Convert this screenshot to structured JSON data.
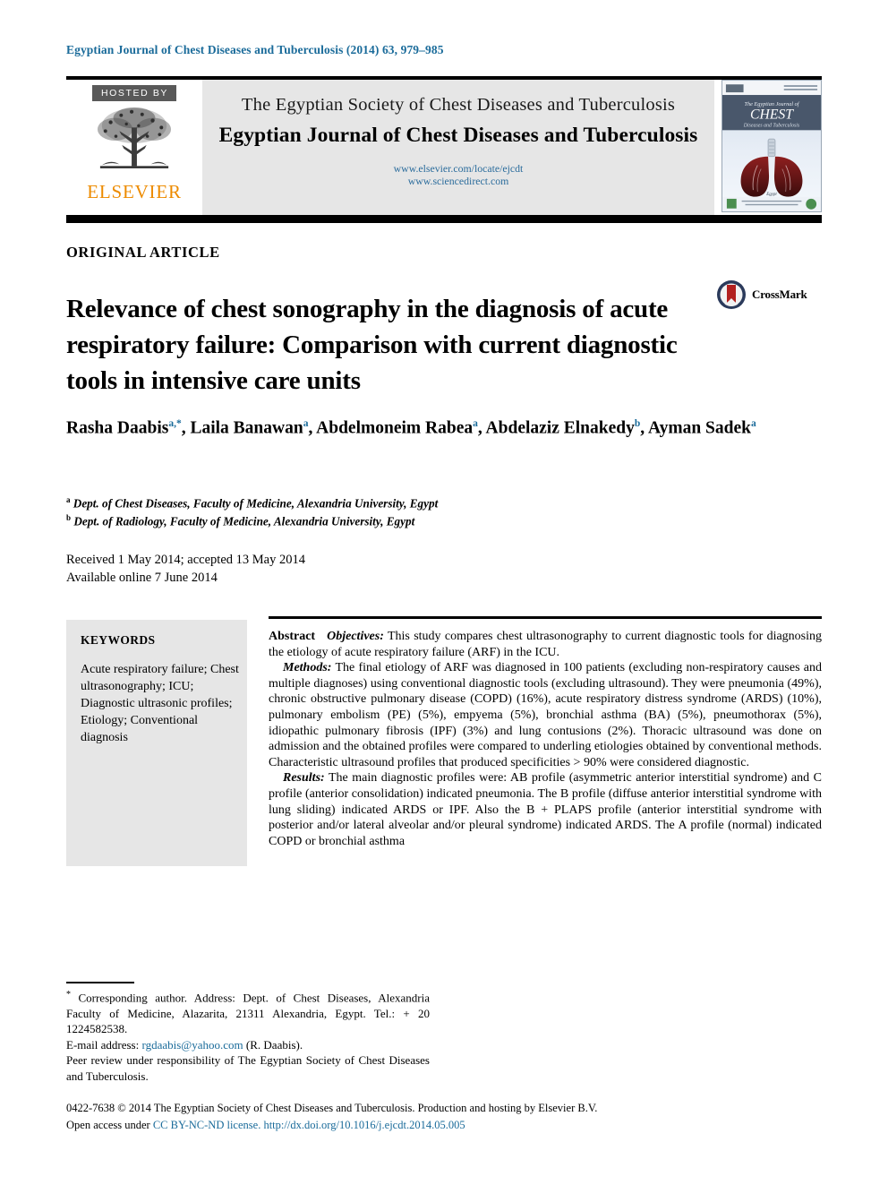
{
  "running_head": "Egyptian Journal of Chest Diseases and Tuberculosis (2014) 63, 979–985",
  "banner": {
    "hosted_by": "HOSTED BY",
    "publisher": "ELSEVIER",
    "society_line": "The Egyptian Society of Chest Diseases and Tuberculosis",
    "journal_line": "Egyptian Journal of Chest Diseases and Tuberculosis",
    "url_1": "www.elsevier.com/locate/ejcdt",
    "url_2": "www.sciencedirect.com",
    "cover": {
      "line1": "The Egyptian Journal of",
      "line2": "CHEST",
      "line3": "Diseases and Tuberculosis",
      "footer": "Egypt"
    }
  },
  "article": {
    "type": "ORIGINAL ARTICLE",
    "title": "Relevance of chest sonography in the diagnosis of acute respiratory failure: Comparison with current diagnostic tools in intensive care units",
    "crossmark_label": "CrossMark",
    "authors_line_1": "Rasha Daabis",
    "authors": [
      {
        "name": "Rasha Daabis",
        "marker": "a,*"
      },
      {
        "name": "Laila Banawan",
        "marker": "a"
      },
      {
        "name": "Abdelmoneim Rabea",
        "marker": "a"
      },
      {
        "name": "Abdelaziz Elnakedy",
        "marker": "b"
      },
      {
        "name": "Ayman Sadek",
        "marker": "a"
      }
    ],
    "affiliations": [
      {
        "marker": "a",
        "text": "Dept. of Chest Diseases, Faculty of Medicine, Alexandria University, Egypt"
      },
      {
        "marker": "b",
        "text": "Dept. of Radiology, Faculty of Medicine, Alexandria University, Egypt"
      }
    ],
    "received": "Received 1 May 2014; accepted 13 May 2014",
    "available": "Available online 7 June 2014"
  },
  "keywords": {
    "heading": "KEYWORDS",
    "items": "Acute respiratory failure; Chest ultrasonography; ICU; Diagnostic ultrasonic profiles; Etiology; Conventional diagnosis"
  },
  "abstract": {
    "heading": "Abstract",
    "objectives_label": "Objectives:",
    "objectives_text": "This study compares chest ultrasonography to current diagnostic tools for diagnosing the etiology of acute respiratory failure (ARF) in the ICU.",
    "methods_label": "Methods:",
    "methods_text": "The final etiology of ARF was diagnosed in 100 patients (excluding non-respiratory causes and multiple diagnoses) using conventional diagnostic tools (excluding ultrasound). They were pneumonia (49%), chronic obstructive pulmonary disease (COPD) (16%), acute respiratory distress syndrome (ARDS) (10%), pulmonary embolism (PE) (5%), empyema (5%), bronchial asthma (BA) (5%), pneumothorax (5%), idiopathic pulmonary fibrosis (IPF) (3%) and lung contusions (2%). Thoracic ultrasound was done on admission and the obtained profiles were compared to underling etiologies obtained by conventional methods. Characteristic ultrasound profiles that produced specificities > 90% were considered diagnostic.",
    "results_label": "Results:",
    "results_text": "The main diagnostic profiles were: AB profile (asymmetric anterior interstitial syndrome) and C profile (anterior consolidation) indicated pneumonia. The B profile (diffuse anterior interstitial syndrome with lung sliding) indicated ARDS or IPF. Also the B + PLAPS profile (anterior interstitial syndrome with posterior and/or lateral alveolar and/or pleural syndrome) indicated ARDS. The A profile (normal) indicated COPD or bronchial asthma"
  },
  "footnote": {
    "corresponding_marker": "*",
    "corresponding": "Corresponding author. Address: Dept. of Chest Diseases, Alexandria Faculty of Medicine, Alazarita, 21311 Alexandria, Egypt. Tel.: + 20 1224582538.",
    "email_label": "E-mail address:",
    "email": "rgdaabis@yahoo.com",
    "email_suffix": "(R. Daabis).",
    "peer_review": "Peer review under responsibility of The Egyptian Society of Chest Diseases and Tuberculosis."
  },
  "colophon": {
    "line1": "0422-7638 © 2014 The Egyptian Society of Chest Diseases and Tuberculosis. Production and hosting by Elsevier B.V.",
    "open_access_prefix": "Open access under",
    "license": "CC BY-NC-ND license.",
    "doi": "http://dx.doi.org/10.1016/j.ejcdt.2014.05.005"
  },
  "colors": {
    "link_blue": "#1a6b9a",
    "elsevier_orange": "#ED8B00",
    "banner_gray": "#e6e6e6"
  }
}
